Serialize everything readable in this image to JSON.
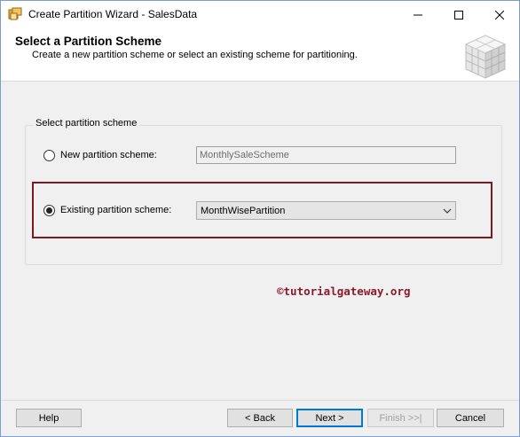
{
  "window": {
    "title": "Create Partition Wizard - SalesData"
  },
  "header": {
    "title": "Select a Partition Scheme",
    "subtitle": "Create a new partition scheme or select an existing scheme for partitioning."
  },
  "group": {
    "label": "Select partition scheme",
    "new_option": {
      "label": "New partition scheme:",
      "selected": false,
      "value": "MonthlySaleScheme"
    },
    "existing_option": {
      "label": "Existing partition scheme:",
      "selected": true,
      "value": "MonthWisePartition"
    }
  },
  "watermark": "©tutorialgateway.org",
  "buttons": {
    "help": "Help",
    "back": "< Back",
    "next": "Next >",
    "finish": "Finish >>|",
    "cancel": "Cancel"
  },
  "colors": {
    "highlight": "#7b1a26",
    "watermark": "#8b1a2b",
    "focus": "#0078d7"
  },
  "icons": {
    "app": "partition-wizard-icon",
    "header": "cube-icon"
  }
}
